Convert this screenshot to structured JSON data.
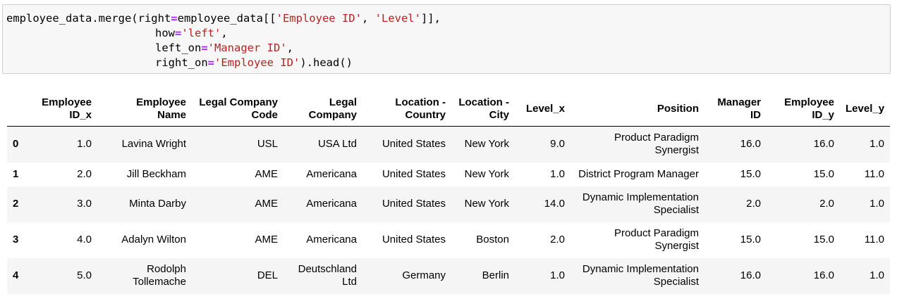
{
  "code_cell": {
    "line1": {
      "a": "employee_data.merge(right",
      "eq": "=",
      "b": "employee_data[[",
      "s1": "'Employee ID'",
      "c": ", ",
      "s2": "'Level'",
      "d": "]],"
    },
    "line2": {
      "a": "how",
      "eq": "=",
      "s": "'left'",
      "d": ","
    },
    "line3": {
      "a": "left_on",
      "eq": "=",
      "s": "'Manager ID'",
      "d": ","
    },
    "line4": {
      "a": "right_on",
      "eq": "=",
      "s": "'Employee ID'",
      "d": ").head()"
    }
  },
  "dataframe": {
    "columns": [
      [
        "Employee",
        "ID_x"
      ],
      [
        "Employee",
        "Name"
      ],
      [
        "Legal Company",
        "Code"
      ],
      [
        "Legal",
        "Company"
      ],
      [
        "Location -",
        "Country"
      ],
      [
        "Location -",
        "City"
      ],
      [
        "Level_x"
      ],
      [
        "Position"
      ],
      [
        "Manager",
        "ID"
      ],
      [
        "Employee",
        "ID_y"
      ],
      [
        "Level_y"
      ]
    ],
    "rows": [
      {
        "index": "0",
        "cells": [
          [
            "1.0"
          ],
          [
            "Lavina Wright"
          ],
          [
            "USL"
          ],
          [
            "USA Ltd"
          ],
          [
            "United States"
          ],
          [
            "New York"
          ],
          [
            "9.0"
          ],
          [
            "Product Paradigm",
            "Synergist"
          ],
          [
            "16.0"
          ],
          [
            "16.0"
          ],
          [
            "1.0"
          ]
        ]
      },
      {
        "index": "1",
        "cells": [
          [
            "2.0"
          ],
          [
            "Jill Beckham"
          ],
          [
            "AME"
          ],
          [
            "Americana"
          ],
          [
            "United States"
          ],
          [
            "New York"
          ],
          [
            "1.0"
          ],
          [
            "District Program Manager"
          ],
          [
            "15.0"
          ],
          [
            "15.0"
          ],
          [
            "11.0"
          ]
        ]
      },
      {
        "index": "2",
        "cells": [
          [
            "3.0"
          ],
          [
            "Minta Darby"
          ],
          [
            "AME"
          ],
          [
            "Americana"
          ],
          [
            "United States"
          ],
          [
            "New York"
          ],
          [
            "14.0"
          ],
          [
            "Dynamic Implementation",
            "Specialist"
          ],
          [
            "2.0"
          ],
          [
            "2.0"
          ],
          [
            "1.0"
          ]
        ]
      },
      {
        "index": "3",
        "cells": [
          [
            "4.0"
          ],
          [
            "Adalyn Wilton"
          ],
          [
            "AME"
          ],
          [
            "Americana"
          ],
          [
            "United States"
          ],
          [
            "Boston"
          ],
          [
            "2.0"
          ],
          [
            "Product Paradigm",
            "Synergist"
          ],
          [
            "15.0"
          ],
          [
            "15.0"
          ],
          [
            "11.0"
          ]
        ]
      },
      {
        "index": "4",
        "cells": [
          [
            "5.0"
          ],
          [
            "Rodolph",
            "Tollemache"
          ],
          [
            "DEL"
          ],
          [
            "Deutschland",
            "Ltd"
          ],
          [
            "Germany"
          ],
          [
            "Berlin"
          ],
          [
            "1.0"
          ],
          [
            "Dynamic Implementation",
            "Specialist"
          ],
          [
            "16.0"
          ],
          [
            "16.0"
          ],
          [
            "1.0"
          ]
        ]
      }
    ]
  }
}
